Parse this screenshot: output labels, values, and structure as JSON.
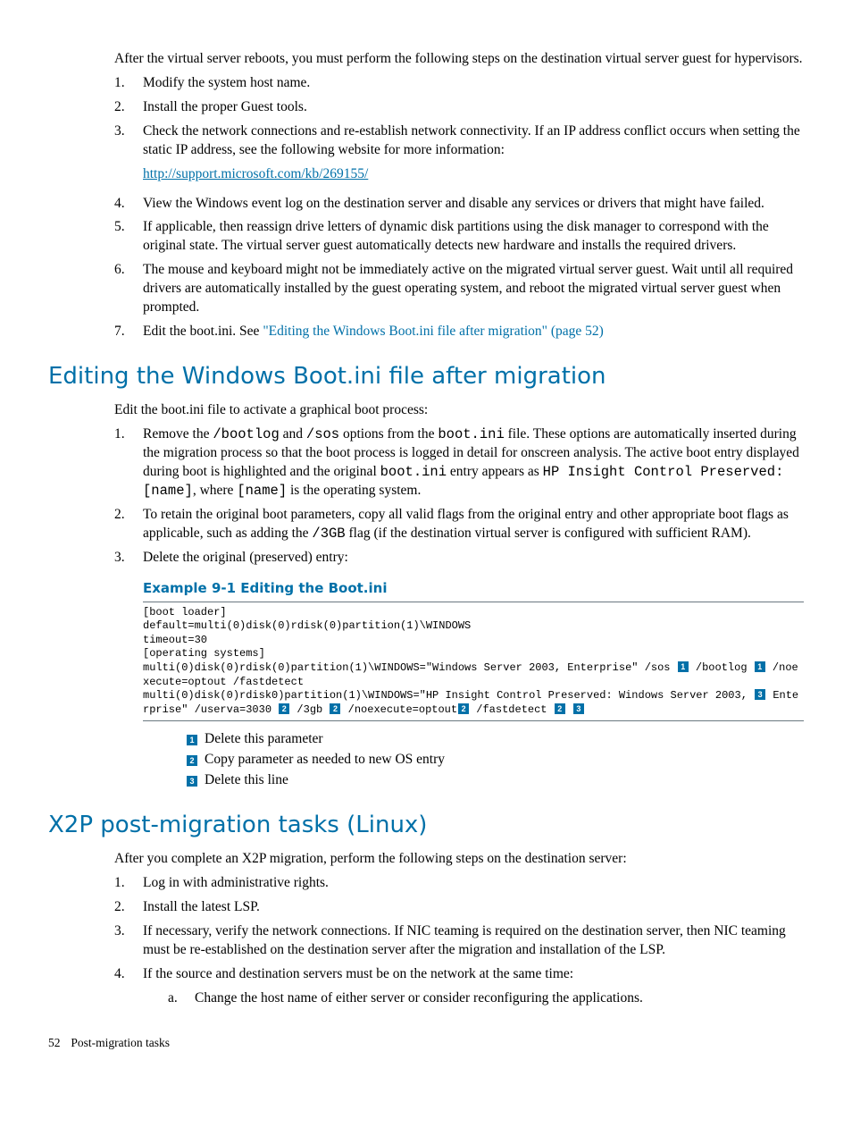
{
  "intro": "After the virtual server reboots, you must perform the following steps on the destination virtual server guest for hypervisors.",
  "steps1": {
    "n1": "1.",
    "t1": "Modify the system host name.",
    "n2": "2.",
    "t2": "Install the proper Guest tools.",
    "n3": "3.",
    "t3": "Check the network connections and re-establish network connectivity. If an IP address conflict occurs when setting the static IP address, see the following website for more information:",
    "link": "http://support.microsoft.com/kb/269155/",
    "n4": "4.",
    "t4": "View the Windows event log on the destination server and disable any services or drivers that might have failed.",
    "n5": "5.",
    "t5": "If applicable, then reassign drive letters of dynamic disk partitions using the disk manager to correspond with the original state. The virtual server guest automatically detects new hardware and installs the required drivers.",
    "n6": "6.",
    "t6": "The mouse and keyboard might not be immediately active on the migrated virtual server guest. Wait until all required drivers are automatically installed by the guest operating system, and reboot the migrated virtual server guest when prompted.",
    "n7": "7.",
    "t7a": "Edit the boot.ini. See ",
    "t7b": "\"Editing the Windows Boot.ini file after migration\" (page 52)"
  },
  "h1": "Editing the Windows Boot.ini file after migration",
  "edit_intro": "Edit the boot.ini file to activate a graphical boot process:",
  "steps2": {
    "n1": "1.",
    "t1p1": "Remove the ",
    "t1c1": "/bootlog",
    "t1p2": " and ",
    "t1c2": "/sos",
    "t1p3": " options from the ",
    "t1c3": "boot.ini",
    "t1p4": " file. These options are automatically inserted during the migration process so that the boot process is logged in detail for onscreen analysis. The active boot entry displayed during boot is highlighted and the original ",
    "t1c4": "boot.ini",
    "t1p5": " entry appears as ",
    "t1c5": " HP Insight Control Preserved: [name]",
    "t1p6": ", where ",
    "t1c6": "[name]",
    "t1p7": " is the operating system.",
    "n2": "2.",
    "t2p1": "To retain the original boot parameters, copy all valid flags from the original entry and other appropriate boot flags as applicable, such as adding the ",
    "t2c1": "/3GB",
    "t2p2": " flag (if the destination virtual server is configured with sufficient RAM).",
    "n3": "3.",
    "t3": "Delete the original (preserved) entry:"
  },
  "example_title": "Example 9-1 Editing the Boot.ini",
  "code": {
    "l1": "[boot loader]",
    "l2": "default=multi(0)disk(0)rdisk(0)partition(1)\\WINDOWS",
    "l3": "timeout=30",
    "l4": "[operating systems]",
    "l5a": "multi(0)disk(0)rdisk(0)partition(1)\\WINDOWS=\"Windows Server 2003, Enterprise\" /sos ",
    "l5b": " /bootlog ",
    "l5c": " /noexecute=optout /fastdetect",
    "l6a": "multi(0)disk(0)rdisk0)partition(1)\\WINDOWS=\"HP Insight Control Preserved: Windows Server 2003, ",
    "l6b": " Enterprise\" /userva=3030 ",
    "l6c": " /3gb ",
    "l6d": " /noexecute=optout",
    "l6e": " /fastdetect "
  },
  "callouts": {
    "c1n": "1",
    "c1t": "Delete this parameter",
    "c2n": "2",
    "c2t": "Copy parameter as needed to new OS entry",
    "c3n": "3",
    "c3t": "Delete this line"
  },
  "h2": "X2P post-migration tasks (Linux)",
  "x2p_intro": "After you complete an X2P migration, perform the following steps on the destination server:",
  "steps3": {
    "n1": "1.",
    "t1": "Log in with administrative rights.",
    "n2": "2.",
    "t2": "Install the latest LSP.",
    "n3": "3.",
    "t3": "If necessary, verify the network connections. If NIC teaming is required on the destination server, then NIC teaming must be re-established on the destination server after the migration and installation of the LSP.",
    "n4": "4.",
    "t4": "If the source and destination servers must be on the network at the same time:",
    "sa_n": "a.",
    "sa_t": "Change the host name of either server or consider reconfiguring the applications."
  },
  "footer": {
    "page": "52",
    "title": "Post-migration tasks"
  }
}
